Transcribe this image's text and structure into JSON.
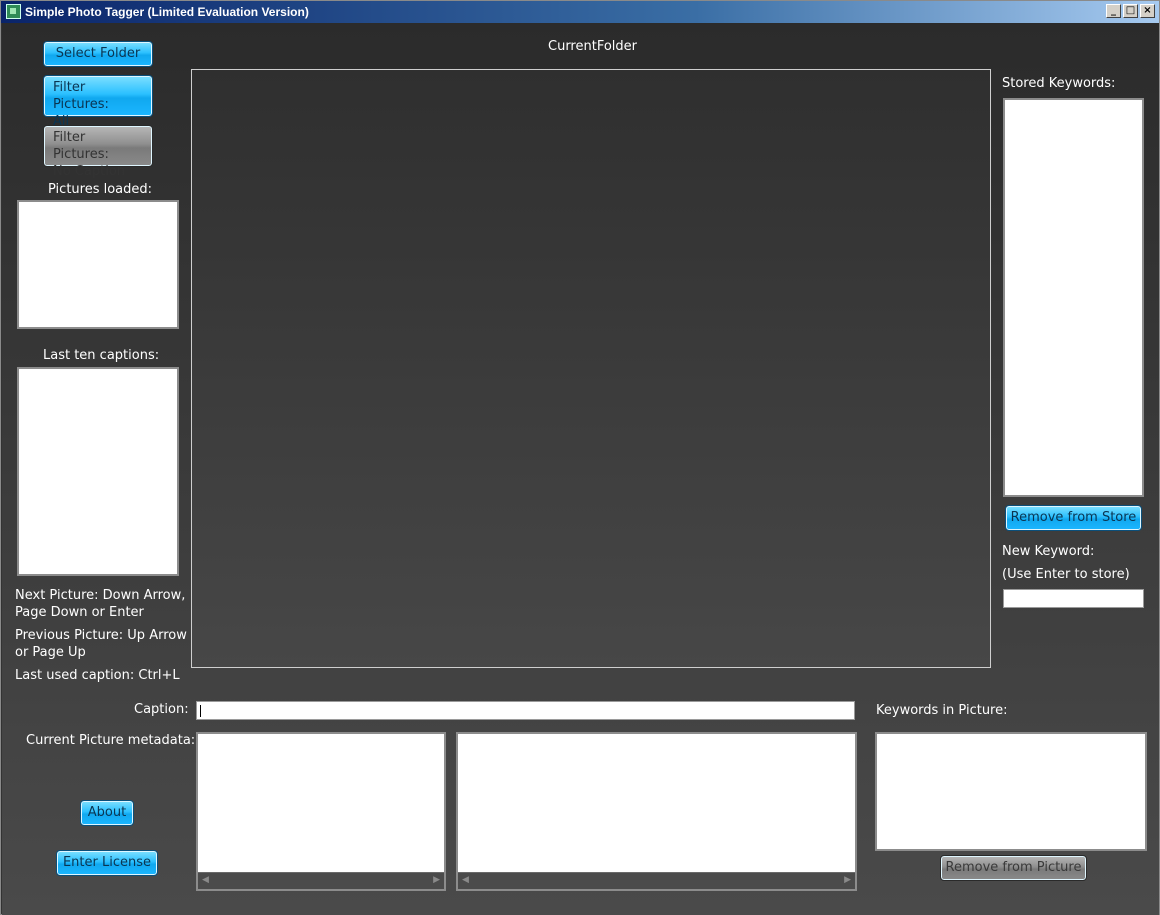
{
  "window": {
    "title": "Simple Photo Tagger (Limited Evaluation Version)",
    "controls": {
      "minimize": "_",
      "maximize": "□",
      "close": "×"
    }
  },
  "left": {
    "select_folder": "Select Folder",
    "filter_all_line1": "Filter Pictures:",
    "filter_all_line2": "All",
    "filter_nocap_line1": "Filter Pictures:",
    "filter_nocap_line2": "No Caption",
    "pictures_loaded": "Pictures loaded:",
    "last_ten_captions": "Last ten captions:",
    "help_next_1": "Next Picture: Down Arrow,",
    "help_next_2": "Page Down or Enter",
    "help_prev_1": "Previous Picture: Up Arrow",
    "help_prev_2": "or Page Up",
    "help_last": "Last used caption: Ctrl+L"
  },
  "center": {
    "current_folder": "CurrentFolder"
  },
  "right": {
    "stored_keywords": "Stored Keywords:",
    "remove_from_store": "Remove from Store",
    "new_keyword": "New Keyword:",
    "use_enter": "(Use Enter to store)"
  },
  "bottom": {
    "caption_label": "Caption:",
    "metadata_label": "Current Picture metadata:",
    "keywords_in_picture": "Keywords in Picture:",
    "about": "About",
    "enter_license": "Enter License",
    "remove_from_picture": "Remove from Picture",
    "scroll_left": "◀",
    "scroll_right": "▶"
  }
}
